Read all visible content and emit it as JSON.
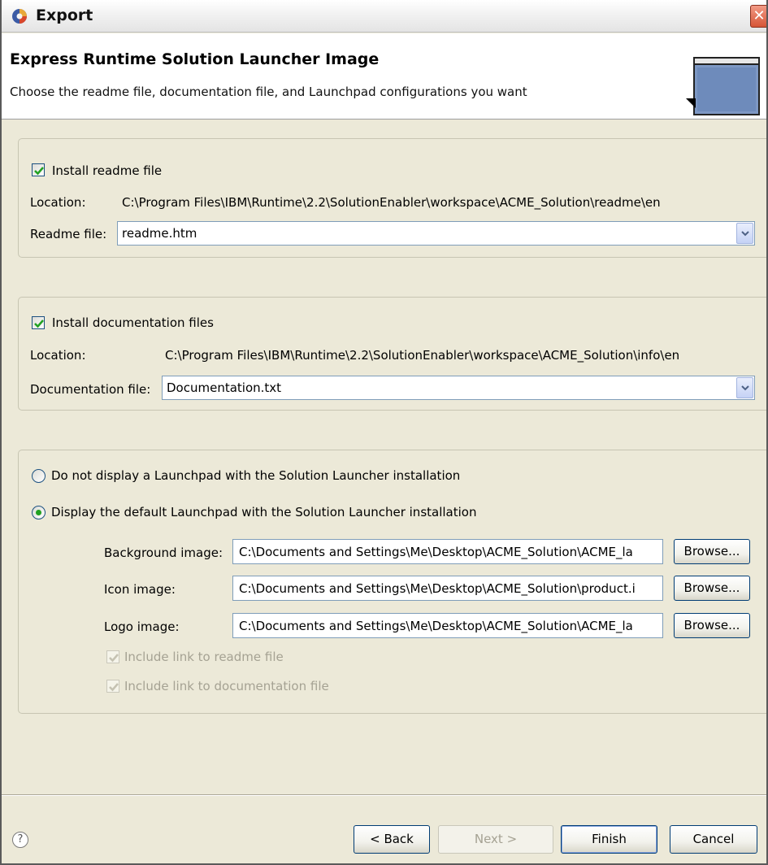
{
  "window": {
    "title": "Export"
  },
  "header": {
    "title": "Express Runtime Solution Launcher Image",
    "description": "Choose the readme file, documentation file, and Launchpad configurations you want"
  },
  "readme_group": {
    "install_label": "Install readme file",
    "install_checked": true,
    "location_label": "Location:",
    "location_value": "C:\\Program Files\\IBM\\Runtime\\2.2\\SolutionEnabler\\workspace\\ACME_Solution\\readme\\en",
    "file_label": "Readme file:",
    "file_value": "readme.htm"
  },
  "docs_group": {
    "install_label": "Install documentation files",
    "install_checked": true,
    "location_label": "Location:",
    "location_value": "C:\\Program Files\\IBM\\Runtime\\2.2\\SolutionEnabler\\workspace\\ACME_Solution\\info\\en",
    "file_label": "Documentation file:",
    "file_value": "Documentation.txt"
  },
  "launchpad_group": {
    "option_none_label": "Do not display a Launchpad with the Solution Launcher installation",
    "option_default_label": "Display the default Launchpad with the Solution Launcher installation",
    "selected": "default",
    "background_label": "Background image:",
    "background_value": "C:\\Documents and Settings\\Me\\Desktop\\ACME_Solution\\ACME_la",
    "icon_label": "Icon image:",
    "icon_value": "C:\\Documents and Settings\\Me\\Desktop\\ACME_Solution\\product.i",
    "logo_label": "Logo image:",
    "logo_value": "C:\\Documents and Settings\\Me\\Desktop\\ACME_Solution\\ACME_la",
    "browse_label": "Browse...",
    "link_readme_label": "Include link to readme file",
    "link_docs_label": "Include link to documentation file"
  },
  "footer": {
    "help_glyph": "?",
    "back_label": "< Back",
    "next_label": "Next >",
    "finish_label": "Finish",
    "cancel_label": "Cancel"
  }
}
